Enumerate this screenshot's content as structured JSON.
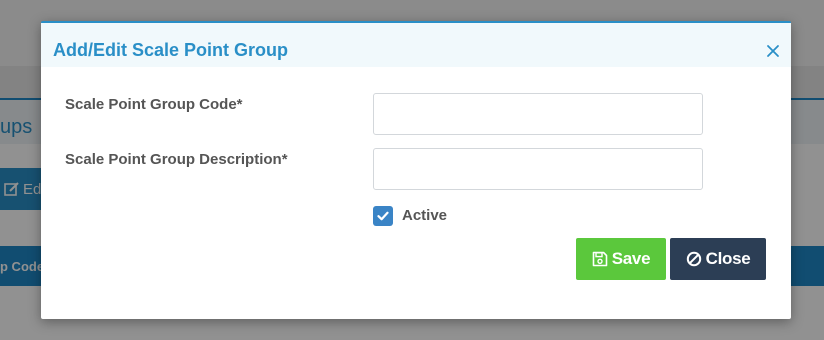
{
  "background": {
    "page_title_fragment": "ups",
    "edit_button_fragment": "Ed",
    "table_header_fragment": "p Code"
  },
  "modal": {
    "title": "Add/Edit Scale Point Group",
    "fields": [
      {
        "label": "Scale Point Group Code*",
        "value": "",
        "placeholder": ""
      },
      {
        "label": "Scale Point Group Description*",
        "value": "",
        "placeholder": ""
      }
    ],
    "active_label": "Active",
    "active_checked": true,
    "save_label": "Save",
    "close_label": "Close"
  },
  "colors": {
    "accent": "#2a8fc7",
    "save": "#5bc83c",
    "close": "#2c3e55",
    "checkbox": "#3a84c6"
  },
  "icons": {
    "close": "close-icon",
    "checkbox": "checkmark-icon",
    "save": "floppy-disk-icon",
    "cancel": "ban-icon",
    "edit": "edit-icon"
  }
}
